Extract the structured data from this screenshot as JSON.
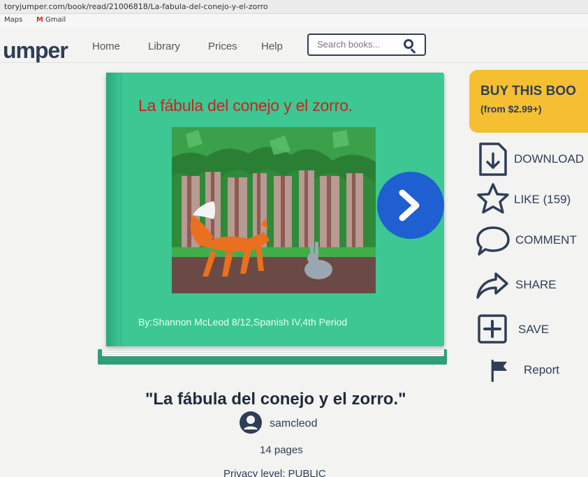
{
  "browser": {
    "url": "toryjumper.com/book/read/21006818/La-fabula-del-conejo-y-el-zorro",
    "bookmarks": [
      "Maps",
      "Gmail"
    ]
  },
  "nav": {
    "logo": "umper",
    "links": [
      "Home",
      "Library",
      "Prices",
      "Help"
    ],
    "search_placeholder": "Search books..."
  },
  "book": {
    "cover_title": "La fábula del conejo y el zorro.",
    "cover_byline": "By:Shannon McLeod 8/12,Spanish IV,4th Period",
    "cover_color": "#3cc793"
  },
  "sidebar": {
    "buy_title": "BUY THIS BOO",
    "buy_price": "(from $2.99+)",
    "actions": {
      "download": "DOWNLOAD",
      "like": "LIKE (159)",
      "comment": "COMMENT",
      "share": "SHARE",
      "save": "SAVE",
      "report": "Report"
    }
  },
  "details": {
    "title": "\"La fábula del conejo y el zorro.\"",
    "author": "samcleod",
    "pages": "14 pages",
    "privacy": "Privacy level: PUBLIC"
  },
  "colors": {
    "accent": "#2f3e57",
    "next_button": "#1f5fd1",
    "buy": "#f6bf32"
  }
}
